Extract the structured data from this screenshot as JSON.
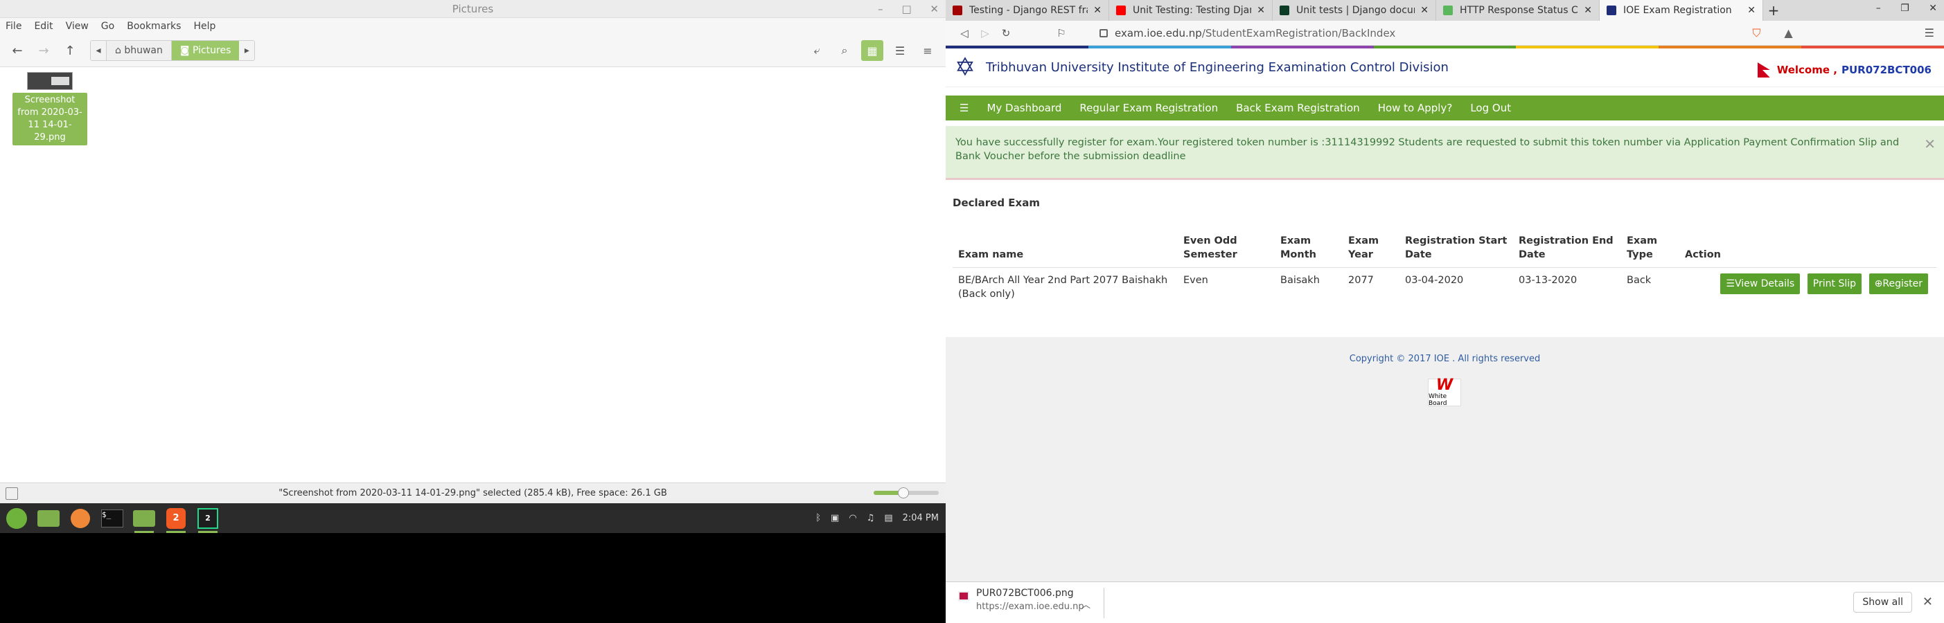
{
  "file_manager": {
    "window_title": "Pictures",
    "menu": [
      "File",
      "Edit",
      "View",
      "Go",
      "Bookmarks",
      "Help"
    ],
    "breadcrumb": [
      "bhuwan",
      "Pictures"
    ],
    "file_label": "Screenshot from 2020-03-11 14-01-29.png",
    "status_text": "\"Screenshot from 2020-03-11 14-01-29.png\" selected (285.4 kB), Free space: 26.1 GB",
    "zoom_level": 0.46
  },
  "panel": {
    "clock": "2:04 PM",
    "badge_brave": "2",
    "badge_pycharm": "2"
  },
  "browser": {
    "tabs": [
      {
        "title": "Testing - Django REST framework",
        "fav_color": "#a30000"
      },
      {
        "title": "Unit Testing: Testing Django and",
        "fav_color": "#ff0000"
      },
      {
        "title": "Unit tests | Django documentation",
        "fav_color": "#0c3c26"
      },
      {
        "title": "HTTP Response Status Codes",
        "fav_color": "#5bb75b"
      },
      {
        "title": "IOE Exam Registration",
        "fav_color": "#1d2d7a"
      }
    ],
    "url_domain": "exam.ioe.edu.np",
    "url_path": "/StudentExamRegistration/BackIndex"
  },
  "site": {
    "title": "Tribhuvan University Institute of Engineering Examination Control Division",
    "welcome_prefix": "Welcome ,",
    "user_id": "PUR072BCT006",
    "nav": [
      "My Dashboard",
      "Regular Exam Registration",
      "Back Exam Registration",
      "How to Apply?",
      "Log Out"
    ],
    "alert": "You have successfully register for exam.Your registered token number is :31114319992 Students are requested to submit this token number via Application Payment Confirmation Slip and Bank Voucher before the submission deadline",
    "panel_title": "Declared Exam",
    "table": {
      "headers": [
        "Exam name",
        "Even Odd Semester",
        "Exam Month",
        "Exam Year",
        "Registration Start Date",
        "Registration End Date",
        "Exam Type",
        "Action"
      ],
      "row": {
        "exam_name": "BE/BArch All Year 2nd Part 2077 Baishakh (Back only)",
        "semester": "Even",
        "month": "Baisakh",
        "year": "2077",
        "start": "03-04-2020",
        "end": "03-13-2020",
        "type": "Back"
      },
      "buttons": {
        "view": "View Details",
        "print": "Print Slip",
        "register": "Register"
      }
    },
    "copyright": "Copyright © 2017 IOE . All rights reserved",
    "whiteboard_logo": "White Board",
    "colors": {
      "nav": "#6aa62e",
      "button": "#5aa02c",
      "alert_bg": "#e2f0d9",
      "alert_text": "#3c763d"
    }
  },
  "download": {
    "filename": "PUR072BCT006.png",
    "source": "https://exam.ioe.edu.np",
    "show_all": "Show all"
  }
}
